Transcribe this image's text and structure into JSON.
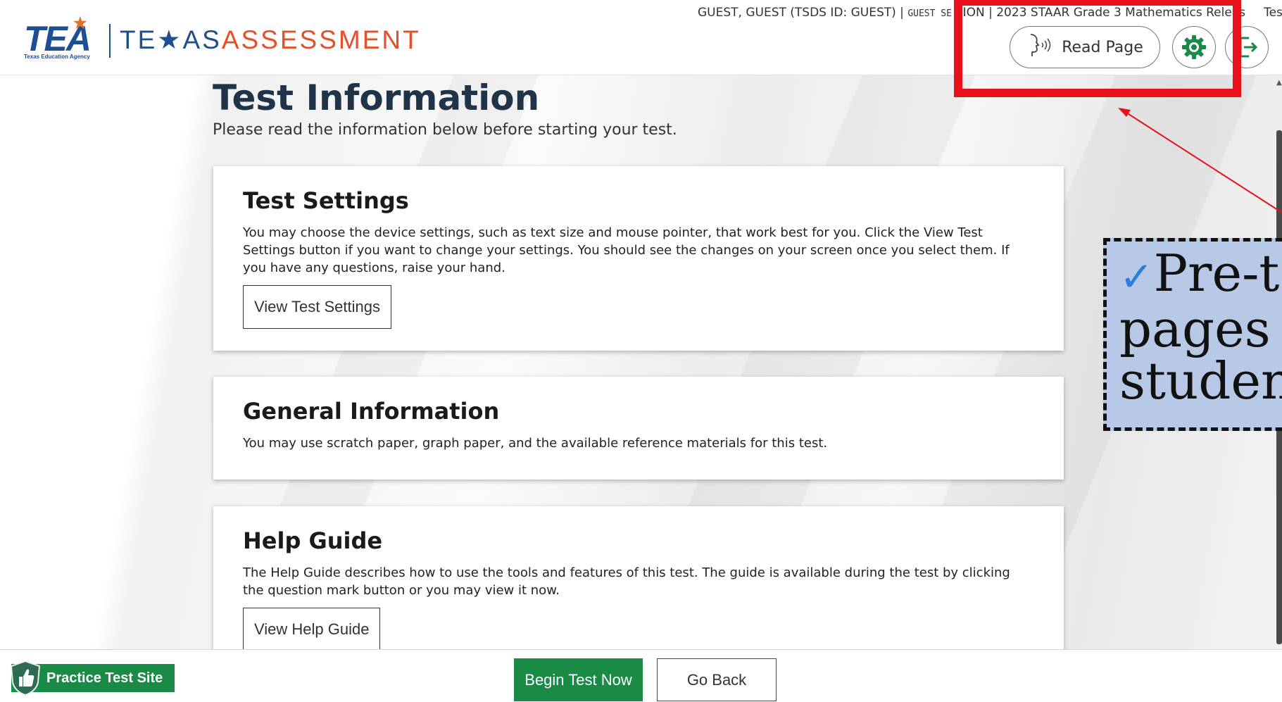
{
  "header": {
    "logo_tea": "TEA",
    "logo_tea_sub": "Texas Education Agency",
    "logo_texas": "TE★AS",
    "logo_assessment": "ASSESSMENT",
    "user_info": "GUEST, GUEST (TSDS ID: GUEST) | ",
    "session_info": "GUEST SE",
    "session_tail": "ION | 2023 STAAR Grade 3 Mathematics Releas",
    "test_label": "Test",
    "read_page_label": "Read Page",
    "icons": {
      "read_page": "speaking-head-icon",
      "settings": "gear-icon",
      "exit": "exit-icon"
    }
  },
  "main": {
    "title": "Test Information",
    "subtitle": "Please read the information below before starting your test.",
    "cards": [
      {
        "heading": "Test Settings",
        "body": "You may choose the device settings, such as text size and mouse pointer, that work best for you. Click the View Test Settings button if you want to change your settings. You should see the changes on your screen once you select them. If you have any questions, raise your hand.",
        "button": "View Test Settings"
      },
      {
        "heading": "General Information",
        "body": "You may use scratch paper, graph paper, and the available reference materials for this test."
      },
      {
        "heading": "Help Guide",
        "body": "The Help Guide describes how to use the tools and features of this test. The guide is available during the test by clicking the question mark button or you may view it now.",
        "button": "View Help Guide"
      }
    ]
  },
  "footer": {
    "practice_label": "Practice Test Site",
    "begin_label": "Begin Test Now",
    "back_label": "Go Back"
  },
  "annotation": {
    "callout_line1": "Pre-te",
    "callout_line2": "pages c",
    "callout_line3": "student"
  },
  "colors": {
    "brand_blue": "#1d4f91",
    "brand_orange": "#e5502a",
    "primary_green": "#1a8a47",
    "highlight_red": "#e8101b",
    "callout_blue": "#b8c9e8",
    "check_blue": "#2b7fd8"
  }
}
